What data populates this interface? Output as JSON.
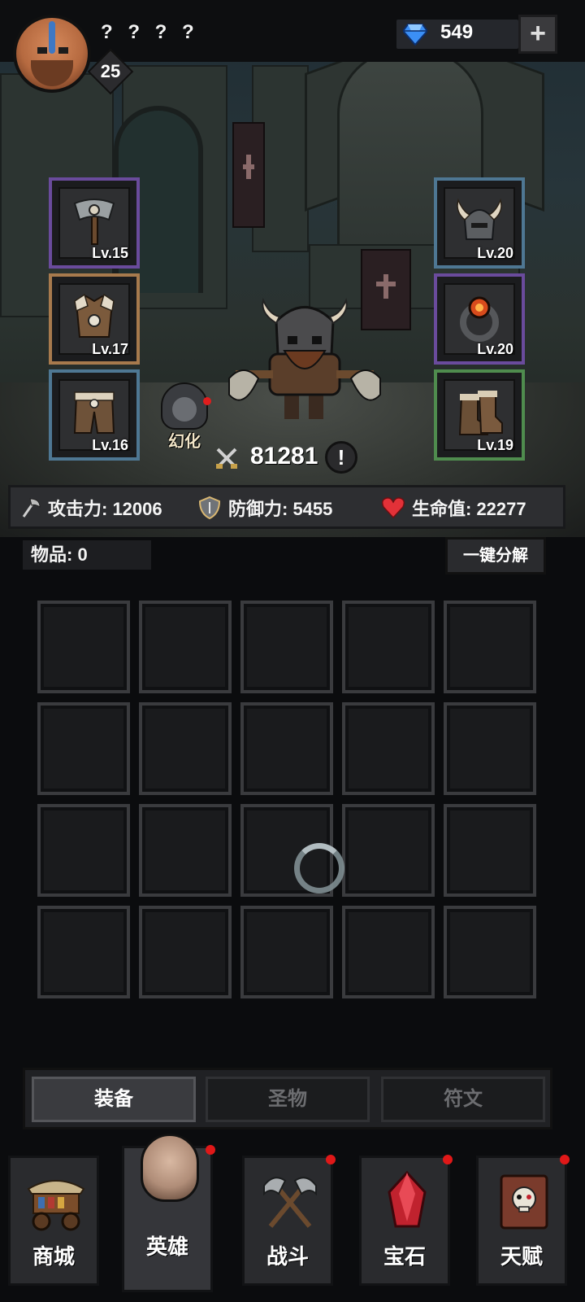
{
  "player": {
    "name": "? ? ? ?",
    "level": "25"
  },
  "currency": {
    "gems": "549",
    "add_label": "+"
  },
  "equipment": {
    "left": [
      {
        "level": "Lv.15"
      },
      {
        "level": "Lv.17"
      },
      {
        "level": "Lv.16"
      }
    ],
    "right": [
      {
        "level": "Lv.20"
      },
      {
        "level": "Lv.20"
      },
      {
        "level": "Lv.19"
      }
    ]
  },
  "hero": {
    "skin_label": "幻化",
    "power": "81281",
    "info_label": "!"
  },
  "stats": {
    "attack": "攻击力: 12006",
    "defense": "防御力: 5455",
    "hp": "生命值: 22277"
  },
  "inventory": {
    "count_label": "物品: 0",
    "decompose_label": "一键分解"
  },
  "subtabs": [
    "装备",
    "圣物",
    "符文"
  ],
  "nav": [
    "商城",
    "英雄",
    "战斗",
    "宝石",
    "天赋"
  ],
  "colors": {
    "accent_red": "#e01818",
    "epic": "#6a4b9c",
    "legendary": "#a77a4d",
    "rare": "#4e7793",
    "uncommon": "#4f8c4e"
  }
}
